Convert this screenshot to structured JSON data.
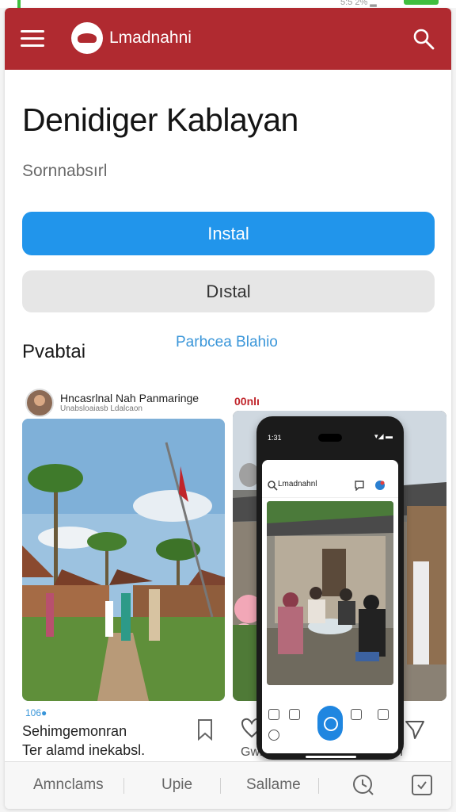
{
  "status_bar": {
    "text": "5:5 2% ▂"
  },
  "app_bar": {
    "brand": "Lmadnahni",
    "color": "#b02a30"
  },
  "app": {
    "title": "Denidiger Kablayan",
    "subtitle": "Sornnabsırl",
    "primary_button": "Instal",
    "secondary_button": "Dıstal"
  },
  "section": {
    "title": "Pvabtai",
    "link": "Parbcea Blahio"
  },
  "post": {
    "name": "Hncasrlnal Nah Panmaringe",
    "meta": "Unabsloaiasb Ldalcaon",
    "count": "00nlı",
    "caption_small": "106●",
    "caption_line1": "Sehimgemonran",
    "caption_line2": "Ter alamd inekabsl."
  },
  "side": {
    "caption_left": "Gwl",
    "caption_right": "lm"
  },
  "phone": {
    "time": "1:31",
    "status_right": "▾◢ ▬",
    "header_title": "Lmadnahnl"
  },
  "bottom_nav": {
    "items": [
      "Amnclams",
      "Upie",
      "Sallame"
    ]
  },
  "icons": {
    "menu": "hamburger-menu-icon",
    "search": "search-icon",
    "bookmark": "bookmark-icon",
    "heart": "heart-icon",
    "share": "share-icon",
    "clock": "clock-icon",
    "checkbox": "checkbox-icon"
  },
  "colors": {
    "primary": "#2195eb",
    "accent": "#b02a30",
    "link": "#3a96d9"
  }
}
